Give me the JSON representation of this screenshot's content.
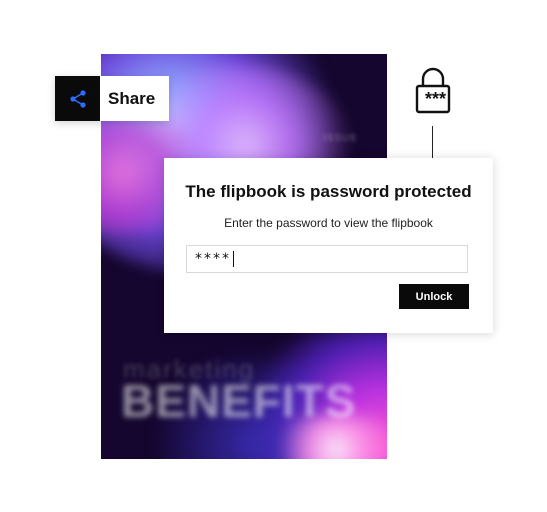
{
  "share": {
    "label": "Share",
    "icon": "share-icon",
    "icon_color": "#2f6bff"
  },
  "lock": {
    "icon": "password-lock-icon",
    "glyph": "***"
  },
  "cover": {
    "small_text": "ISSUE",
    "subtitle": "marketing",
    "title": "BENEFITS"
  },
  "dialog": {
    "title": "The flipbook is password protected",
    "subtitle": "Enter the password to view the flipbook",
    "password_value": "****",
    "unlock_label": "Unlock"
  }
}
